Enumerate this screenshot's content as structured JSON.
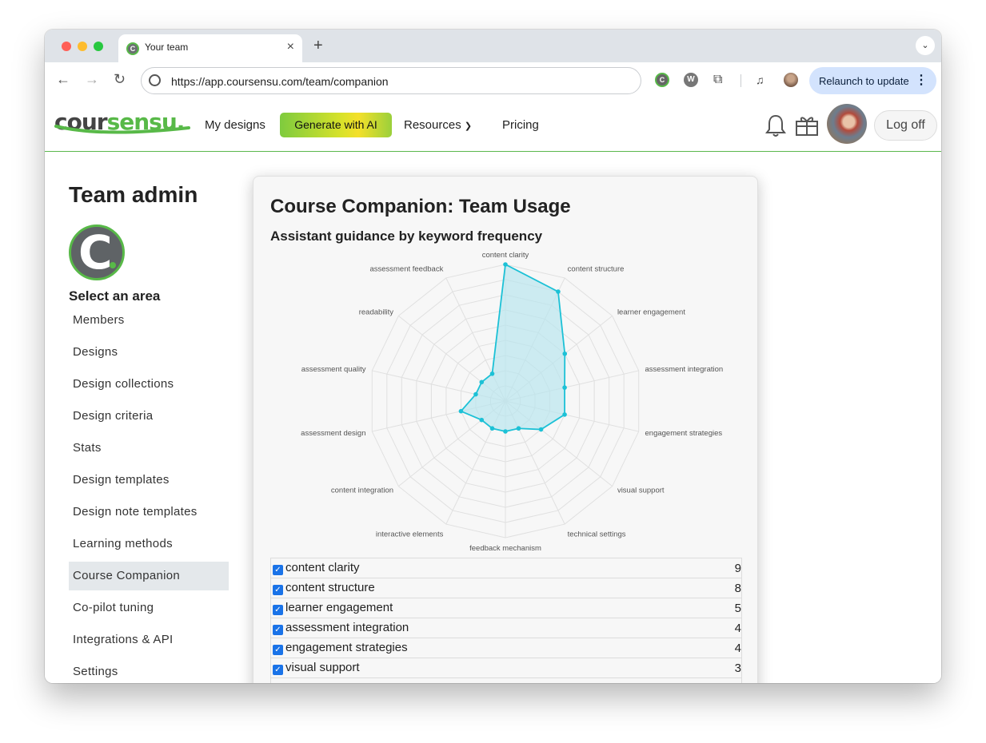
{
  "browser": {
    "tab_title": "Your team",
    "url": "https://app.coursensu.com/team/companion",
    "relaunch_label": "Relaunch to update",
    "favicon_letter": "C"
  },
  "header": {
    "logo_part1": "cour",
    "logo_part2": "sensu.",
    "nav": {
      "my_designs": "My designs",
      "generate_ai": "Generate with AI",
      "resources": "Resources",
      "pricing": "Pricing"
    },
    "logoff": "Log off"
  },
  "sidebar": {
    "title": "Team admin",
    "logo_letter": "C",
    "select_label": "Select an area",
    "items": [
      {
        "label": "Members"
      },
      {
        "label": "Designs"
      },
      {
        "label": "Design collections"
      },
      {
        "label": "Design criteria"
      },
      {
        "label": "Stats"
      },
      {
        "label": "Design templates"
      },
      {
        "label": "Design note templates"
      },
      {
        "label": "Learning methods"
      },
      {
        "label": "Course Companion",
        "active": true
      },
      {
        "label": "Co-pilot tuning"
      },
      {
        "label": "Integrations & API"
      },
      {
        "label": "Settings"
      }
    ]
  },
  "card": {
    "title": "Course Companion: Team Usage",
    "subtitle": "Assistant guidance by keyword frequency"
  },
  "colors": {
    "brand_green": "#58b948",
    "series_line": "#1cc1d6",
    "series_fill": "#b9e6ee"
  },
  "chart_data": {
    "type": "radar",
    "title": "Assistant guidance by keyword frequency",
    "categories": [
      "content clarity",
      "content structure",
      "learner engagement",
      "assessment integration",
      "engagement strategies",
      "visual support",
      "technical settings",
      "feedback mechanism",
      "interactive elements",
      "content integration",
      "assessment design",
      "assessment quality",
      "readability",
      "assessment feedback"
    ],
    "values": [
      9,
      8,
      5,
      4,
      4,
      3,
      2,
      2,
      2,
      2,
      3,
      2,
      2,
      2
    ],
    "rmax": 9,
    "rings": 9
  },
  "table": {
    "rows": [
      {
        "label": "content clarity",
        "value": "9"
      },
      {
        "label": "content structure",
        "value": "8"
      },
      {
        "label": "learner engagement",
        "value": "5"
      },
      {
        "label": "assessment integration",
        "value": "4"
      },
      {
        "label": "engagement strategies",
        "value": "4"
      },
      {
        "label": "visual support",
        "value": "3"
      },
      {
        "label": "",
        "value": ""
      }
    ]
  }
}
